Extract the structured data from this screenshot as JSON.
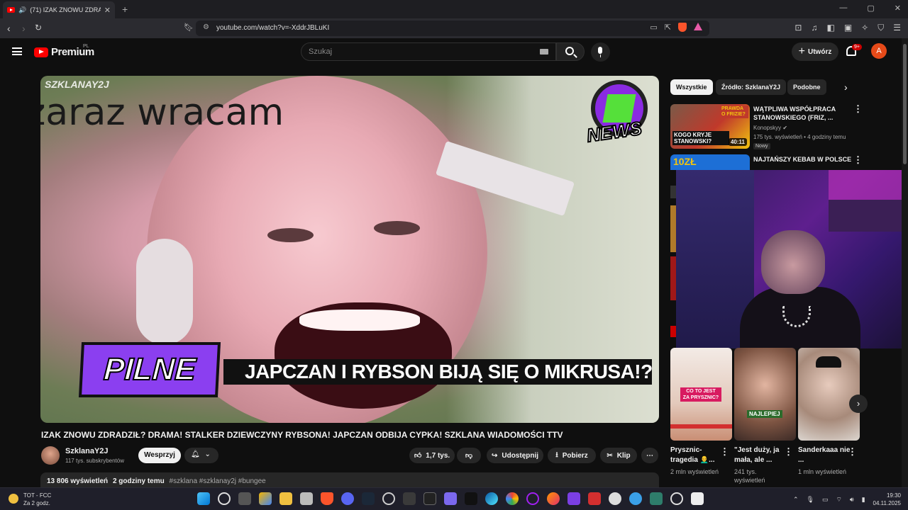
{
  "browser": {
    "tab_title": "(71) IZAK ZNOWU ZDRADZIŁ!...",
    "url": "youtube.com/watch?v=-XddrJBLuKI",
    "new_tab": "+",
    "close": "✕",
    "win_min": "—",
    "win_max": "▢",
    "win_close": "✕"
  },
  "youtube": {
    "logo_word": "Premium",
    "logo_region": "PL",
    "search_placeholder": "Szukaj",
    "create_label": "Utwórz",
    "notif_badge": "9+",
    "avatar_letter": "A"
  },
  "video": {
    "watermark": "SZKLANAY2J",
    "overlay_text": "zaraz wracam",
    "news_logo": "NEWS",
    "pilne": "PILNE",
    "ticker": "JAPCZAN I RYBSON BIJĄ SIĘ O MIKRUSA!? STAR",
    "title": "IZAK ZNOWU ZDRADZIŁ? DRAMA! STALKER DZIEWCZYNY RYBSONA! JAPCZAN ODBIJA CYPKA! SZKLANA WIADOMOŚCI TTV",
    "channel_name": "SzklanaY2J",
    "channel_subs": "117 tys. subskrybentów",
    "support_label": "Wesprzyj",
    "likes": "1,7 tys.",
    "share_label": "Udostępnij",
    "download_label": "Pobierz",
    "clip_label": "Klip",
    "views": "13 806 wyświetleń",
    "age": "2 godziny temu",
    "tags": "#szklana #szklanay2j #bungee"
  },
  "sidebar": {
    "chips": [
      "Wszystkie",
      "Źródło: SzklanaY2J",
      "Podobne"
    ],
    "recs": [
      {
        "title": "WĄTPLIWA WSPÓŁPRACA STANOWSKIEGO (FRIZ, ...",
        "channel": "Konopskyy",
        "meta": "175 tys. wyświetleń • 4 godziny temu",
        "badge": "Nowy",
        "duration": "40:11",
        "thumb_text_1": "PRAWDA O FRIZIE?",
        "thumb_text_2": "KOGO KRYJE STANOWSKI?"
      },
      {
        "title": "NAJTAŃSZY KEBAB W POLSCE",
        "thumb_text": "10ZŁ"
      }
    ],
    "shorts": [
      {
        "title": "Prysznic-tragedia 👨‍🦲...",
        "views": "2 mln wyświetleń",
        "caption": "CO TO JEST ZA PRYSZNIC?"
      },
      {
        "title": "\"Jest duży, ja mała, ale ...",
        "views": "241 tys. wyświetleń",
        "caption": "NAJLEPIEJ"
      },
      {
        "title": "Sanderkaaa nie ...",
        "views": "1 mln wyświetleń",
        "caption": ""
      }
    ]
  },
  "taskbar": {
    "weather_title": "TOT - FCC",
    "weather_sub": "Za 2 godz.",
    "time": "19:30",
    "date": "04.11.2025"
  },
  "colors": {
    "accent_red": "#ff0000",
    "bg": "#0f0f0f",
    "pilne_purple": "#8b3ff0",
    "news_green": "#55e03a"
  }
}
